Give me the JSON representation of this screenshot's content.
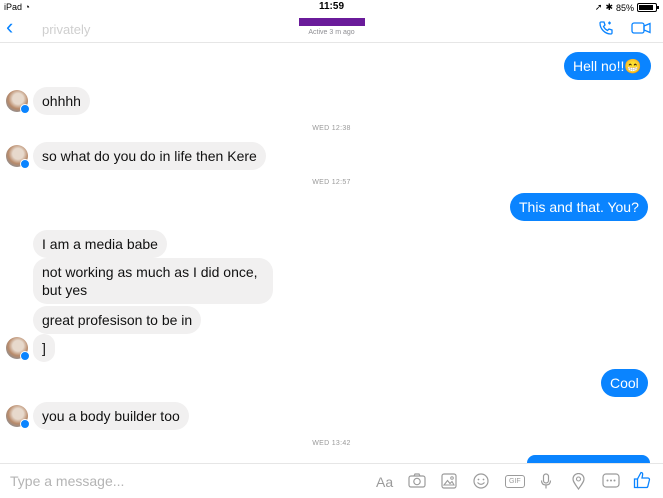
{
  "status": {
    "device": "iPad",
    "time": "11:59",
    "battery": "85%",
    "battery_level": 0.85
  },
  "header": {
    "ghost_text": "privately",
    "active_status": "Active 3 m ago"
  },
  "messages": [
    {
      "text": "Hell no!!😁"
    },
    {
      "text": "ohhhh"
    },
    {
      "text": "WED 12:38"
    },
    {
      "text": "so what do you do in life then Kere"
    },
    {
      "text": "WED 12:57"
    },
    {
      "text": "This and that. You?"
    },
    {
      "text": "I am a media babe"
    },
    {
      "text": "not working as much as I did once, but yes"
    },
    {
      "text": "great profesison to be in"
    },
    {
      "text": "]"
    },
    {
      "text": "Cool"
    },
    {
      "text": "you a body builder too"
    },
    {
      "text": "WED 13:42"
    }
  ],
  "composer": {
    "placeholder": "Type a message...",
    "aa": "Aa",
    "gif": "GIF"
  },
  "colors": {
    "accent": "#0a84ff",
    "incoming": "#f1f0f0",
    "redaction": "#6a1b9a"
  }
}
